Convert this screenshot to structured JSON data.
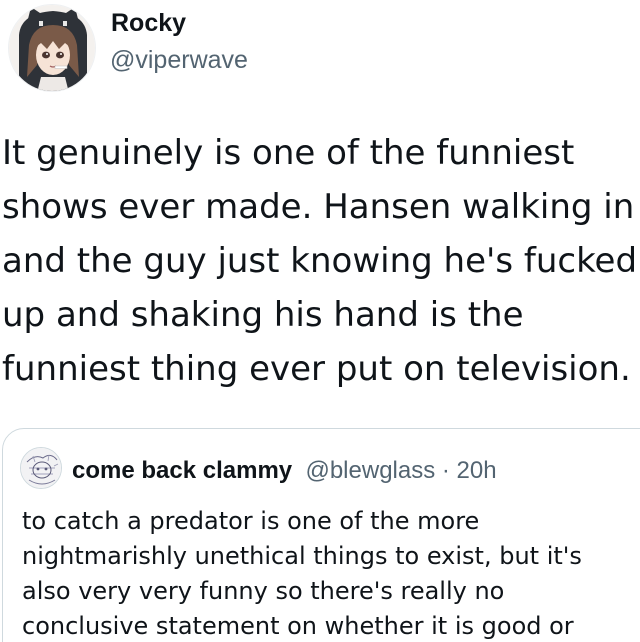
{
  "author": {
    "display_name": "Rocky",
    "handle": "@viperwave",
    "avatar_icon": "anime-avatar-icon"
  },
  "tweet": {
    "lines": [
      "It genuinely is one of the funniest",
      "shows ever made. Hansen walking in",
      "and the guy just knowing he's fucked",
      "up and shaking his hand is the",
      "funniest thing ever put on television."
    ]
  },
  "quoted_tweet": {
    "display_name": "come back clammy",
    "handle": "@blewglass",
    "separator": " · ",
    "time": "20h",
    "avatar_icon": "sketch-avatar-icon",
    "lines": [
      "to catch a predator is one of the more",
      "nightmarishly unethical things to exist, but it's",
      "also very very funny so there's really no",
      "conclusive statement on whether it is good or"
    ]
  },
  "colors": {
    "text_primary": "#0f1419",
    "text_secondary": "#536471",
    "border": "#cfd9de"
  }
}
